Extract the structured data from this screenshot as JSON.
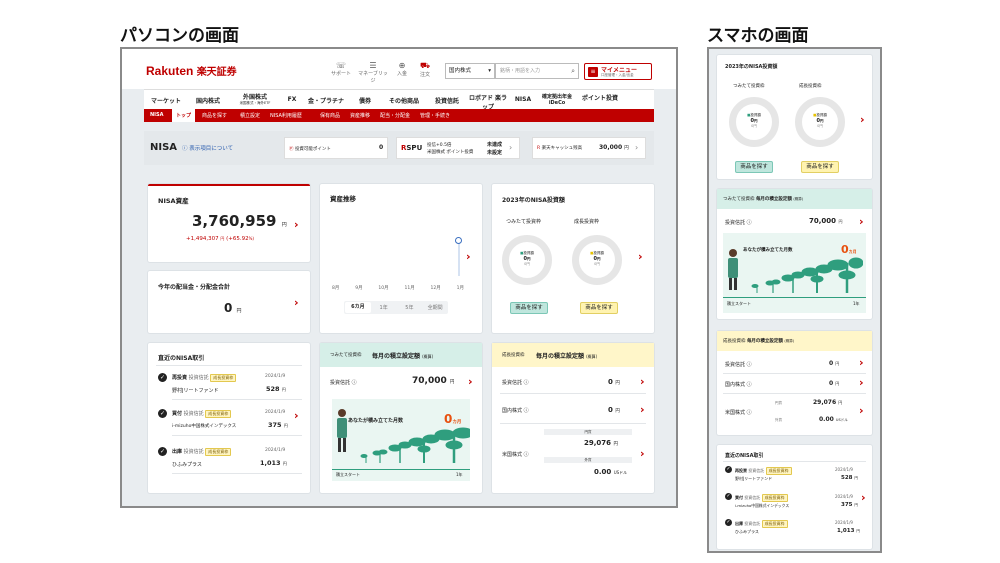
{
  "captions": {
    "pc": "パソコンの画面",
    "sp": "スマホの画面"
  },
  "header": {
    "logo": "Rakuten",
    "logo_jp": "楽天証券",
    "icons": [
      {
        "label": "サポート",
        "icon": "support-icon"
      },
      {
        "label": "マネーブリッジ",
        "icon": "bridge-icon"
      },
      {
        "label": "入金",
        "icon": "deposit-icon"
      },
      {
        "label": "注文",
        "icon": "cart-icon"
      }
    ],
    "market_select": "国内株式",
    "search_placeholder": "銘柄・用語を入力",
    "mymenu": "マイメニュー",
    "mymenu_sub": "口座管理・入金/出金"
  },
  "nav": [
    "マーケット",
    "国内株式",
    "外国株式",
    "FX",
    "金・プラチナ",
    "債券",
    "その他商品",
    "投資信託",
    "ロボアド 楽ラップ",
    "NISA",
    "確定拠出年金 iDeCo",
    "ポイント投資"
  ],
  "nav_sub": "米国株式・海外ETF",
  "subnav": [
    "NISA",
    "トップ",
    "商品を探す",
    "積立設定",
    "NISA利用履歴",
    "保有商品",
    "資産推移",
    "配当・分配金",
    "管理・手続き"
  ],
  "nisa_bar": {
    "title": "NISA",
    "display_link": "表示項目について",
    "points_label": "投資可能ポイント",
    "points_value": "0",
    "spu": "SPU",
    "spu_line1": "投信+0.5倍",
    "spu_line2": "米国株式 ポイント投資",
    "spu_status1": "未達成",
    "spu_status2": "未設定",
    "cash_label": "楽天キャッシュ残高",
    "cash_value": "30,000",
    "yen": "円"
  },
  "assets": {
    "title": "NISA資産",
    "value": "3,760,959",
    "unit": "円",
    "change": "+1,494,307",
    "change_unit": "円",
    "change_pct": "(+65.92",
    "change_pct_unit": "%)"
  },
  "dividends": {
    "title": "今年の配当金・分配金合計",
    "value": "0",
    "unit": "円"
  },
  "chart": {
    "title": "資産推移",
    "x_labels": [
      "8月",
      "9月",
      "10月",
      "11月",
      "12月",
      "1月"
    ],
    "tabs": [
      "6カ月",
      "1年",
      "5年",
      "全期間"
    ]
  },
  "invest2023": {
    "title": "2023年のNISA投資額",
    "tsumitate": "つみたて投資枠",
    "seicho": "成長投資枠",
    "legend_t": "投資額",
    "legend_s": "投資額",
    "value": "0",
    "unit": "円",
    "sub": "0円",
    "btn": "商品を探す"
  },
  "recent": {
    "title": "直近のNISA取引",
    "rows": [
      {
        "type": "再投資",
        "cat": "投資信託",
        "badge": "成長投資枠",
        "date": "2024/1/9",
        "name": "野村Jリートファンド",
        "amount": "528"
      },
      {
        "type": "買付",
        "cat": "投資信託",
        "badge": "成長投資枠",
        "date": "2024/1/9",
        "name": "i-mizuho中国株式インデックス",
        "amount": "375"
      },
      {
        "type": "出庫",
        "cat": "投資信託",
        "badge": "成長投資枠",
        "date": "2024/1/9",
        "name": "ひふみプラス",
        "amount": "1,013"
      }
    ],
    "unit": "円"
  },
  "tsumitate_card": {
    "tag": "つみたて投資枠",
    "title": "毎月の積立設定額",
    "suffix": "(概算)",
    "row_label": "投資信託",
    "row_value": "70,000",
    "unit": "円",
    "illus_text": "あなたが積み立てた月数",
    "months": "0",
    "months_unit": "カ月",
    "start": "積立スタート",
    "year": "1年"
  },
  "seicho_card": {
    "tag": "成長投資枠",
    "title": "毎月の積立設定額",
    "suffix": "(概算)",
    "rows": [
      {
        "label": "投資信託",
        "value": "0"
      },
      {
        "label": "国内株式",
        "value": "0"
      }
    ],
    "us_label": "米国株式",
    "us_yen_label": "円貨",
    "us_yen": "29,076",
    "us_fx_label": "外貨",
    "us_fx": "0.00",
    "us_fx_unit": "USドル",
    "unit": "円"
  },
  "colors": {
    "brand": "#bf0000",
    "green": "#2f9e7e",
    "yellow": "#fff3b0"
  }
}
